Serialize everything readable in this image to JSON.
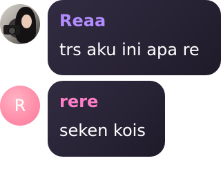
{
  "messages": [
    {
      "username": "Reaa",
      "text": "trs aku ini apa re",
      "avatar": {
        "type": "photo",
        "icon": "user-photo-avatar"
      },
      "name_color": "#b28cff"
    },
    {
      "username": "rere",
      "text": "seken kois",
      "avatar": {
        "type": "letter",
        "letter": "R",
        "color": "#ff8fab"
      },
      "name_color": "#ff7ec8"
    }
  ],
  "bubble_color": "#2a2438"
}
